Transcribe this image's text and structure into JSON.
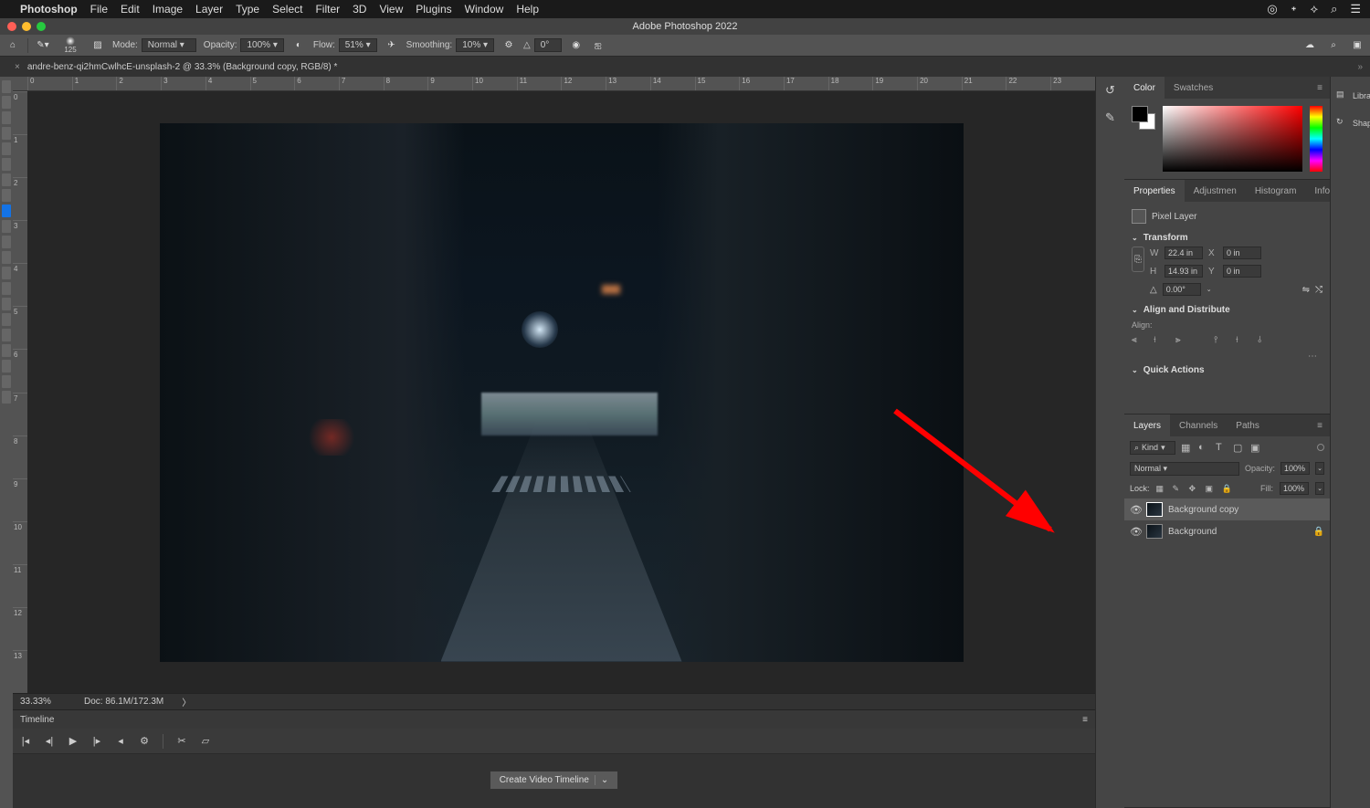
{
  "menubar": {
    "app": "Photoshop",
    "items": [
      "File",
      "Edit",
      "Image",
      "Layer",
      "Type",
      "Select",
      "Filter",
      "3D",
      "View",
      "Plugins",
      "Window",
      "Help"
    ]
  },
  "window_title": "Adobe Photoshop 2022",
  "options": {
    "brush_size": "125",
    "mode_label": "Mode:",
    "mode_value": "Normal",
    "opacity_label": "Opacity:",
    "opacity_value": "100%",
    "flow_label": "Flow:",
    "flow_value": "51%",
    "smoothing_label": "Smoothing:",
    "smoothing_value": "10%",
    "angle_value": "0°"
  },
  "document_tab": "andre-benz-qi2hmCwlhcE-unsplash-2 @ 33.3% (Background copy, RGB/8) *",
  "ruler_h": [
    "0",
    "1",
    "2",
    "3",
    "4",
    "5",
    "6",
    "7",
    "8",
    "9",
    "10",
    "11",
    "12",
    "13",
    "14",
    "15",
    "16",
    "17",
    "18",
    "19",
    "20",
    "21",
    "22",
    "23"
  ],
  "ruler_v": [
    "0",
    "1",
    "2",
    "3",
    "4",
    "5",
    "6",
    "7",
    "8",
    "9",
    "10",
    "11",
    "12",
    "13"
  ],
  "status": {
    "zoom": "33.33%",
    "doc": "Doc: 86.1M/172.3M"
  },
  "timeline": {
    "title": "Timeline",
    "create_label": "Create Video Timeline"
  },
  "color_panel": {
    "tabs": [
      "Color",
      "Swatches"
    ],
    "active": 0
  },
  "properties_panel": {
    "tabs": [
      "Properties",
      "Adjustmen",
      "Histogram",
      "Info"
    ],
    "active": 0,
    "layer_type": "Pixel Layer",
    "transform_label": "Transform",
    "w": "22.4 in",
    "h": "14.93 in",
    "x": "0 in",
    "y": "0 in",
    "rotation": "0.00°",
    "align_label": "Align and Distribute",
    "align_sub": "Align:",
    "quick_label": "Quick Actions"
  },
  "layers_panel": {
    "tabs": [
      "Layers",
      "Channels",
      "Paths"
    ],
    "active": 0,
    "kind_label": "Kind",
    "blend_mode": "Normal",
    "opacity_label": "Opacity:",
    "opacity_value": "100%",
    "lock_label": "Lock:",
    "fill_label": "Fill:",
    "fill_value": "100%",
    "layers": [
      {
        "name": "Background copy",
        "selected": true,
        "locked": false
      },
      {
        "name": "Background",
        "selected": false,
        "locked": true
      }
    ]
  },
  "sliver": {
    "items": [
      "Libra",
      "Shap"
    ]
  }
}
